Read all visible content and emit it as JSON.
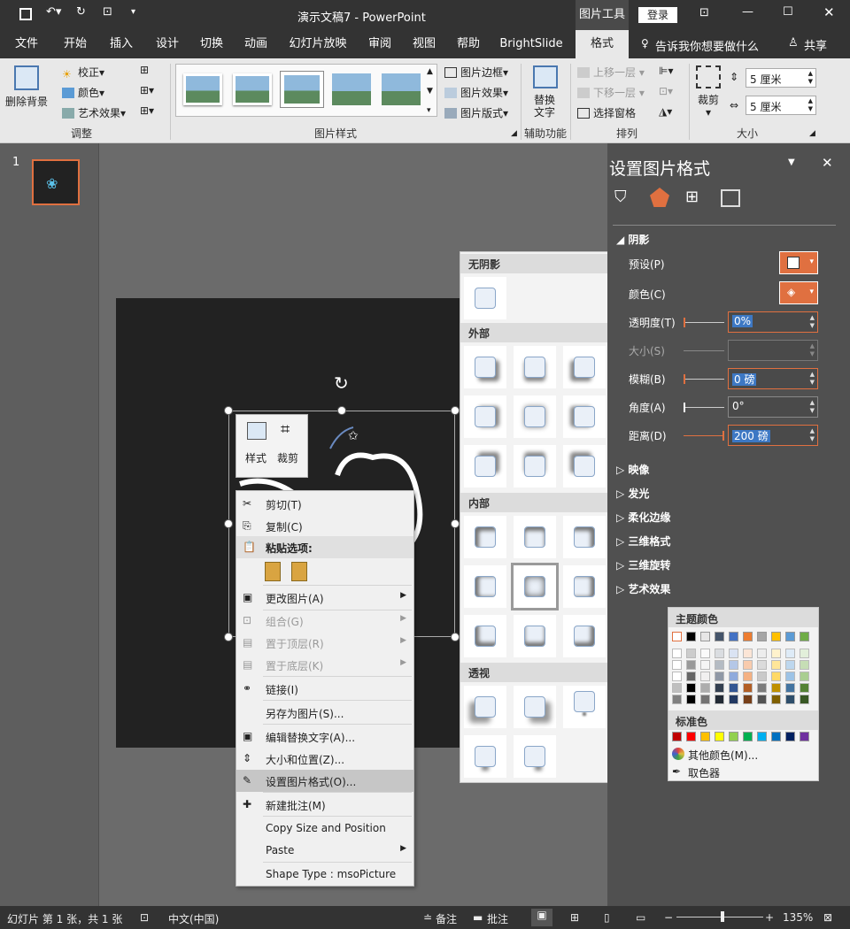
{
  "titlebar": {
    "doc_title": "演示文稿7  -  PowerPoint",
    "context_tab": "图片工具",
    "login": "登录"
  },
  "tabs": [
    "文件",
    "开始",
    "插入",
    "设计",
    "切换",
    "动画",
    "幻灯片放映",
    "审阅",
    "视图",
    "帮助",
    "BrightSlide",
    "格式"
  ],
  "tell_me": "告诉我你想要做什么",
  "share": "共享",
  "ribbon": {
    "remove_bg": "删除背景",
    "correct": "校正",
    "color": "颜色",
    "art_effect": "艺术效果",
    "group_adjust": "调整",
    "group_styles": "图片样式",
    "border": "图片边框",
    "effect": "图片效果",
    "layout": "图片版式",
    "alt_text": "替换\n文字",
    "alt_text_l1": "替换",
    "alt_text_l2": "文字",
    "group_assist": "辅助功能",
    "bring_fwd": "上移一层",
    "send_back": "下移一层",
    "selection_pane": "选择窗格",
    "group_arrange": "排列",
    "crop": "裁剪",
    "height": "5 厘米",
    "width": "5 厘米",
    "group_size": "大小"
  },
  "thumbs": {
    "num": "1"
  },
  "mini_toolbar": {
    "style": "样式",
    "crop": "裁剪"
  },
  "context_menu": [
    {
      "label": "剪切(T)",
      "dis": false
    },
    {
      "label": "复制(C)",
      "dis": false
    },
    {
      "label": "粘贴选项:",
      "dis": false
    },
    {
      "label": "更改图片(A)",
      "dis": false
    },
    {
      "label": "组合(G)",
      "dis": true
    },
    {
      "label": "置于顶层(R)",
      "dis": true
    },
    {
      "label": "置于底层(K)",
      "dis": true
    },
    {
      "label": "链接(I)",
      "dis": false
    },
    {
      "label": "另存为图片(S)...",
      "dis": false
    },
    {
      "label": "编辑替换文字(A)...",
      "dis": false
    },
    {
      "label": "大小和位置(Z)...",
      "dis": false
    },
    {
      "label": "设置图片格式(O)...",
      "dis": false
    },
    {
      "label": "新建批注(M)",
      "dis": false
    },
    {
      "label": "Copy Size and Position",
      "dis": false
    },
    {
      "label": "Paste",
      "dis": false
    },
    {
      "label": "Shape Type : msoPicture",
      "dis": false
    }
  ],
  "gallery": {
    "no_shadow": "无阴影",
    "outer": "外部",
    "inner": "内部",
    "perspective": "透视"
  },
  "pane": {
    "title": "设置图片格式",
    "shadow": "阴影",
    "preset": "预设(P)",
    "color": "颜色(C)",
    "transparency": "透明度(T)",
    "transparency_val": "0%",
    "size": "大小(S)",
    "blur": "模糊(B)",
    "blur_val": "0 磅",
    "angle": "角度(A)",
    "angle_val": "0°",
    "distance": "距离(D)",
    "distance_val": "200 磅",
    "reflection": "映像",
    "glow": "发光",
    "soft_edges": "柔化边缘",
    "format_3d": "三维格式",
    "rotation_3d": "三维旋转",
    "art_effects": "艺术效果"
  },
  "color_popup": {
    "theme": "主题颜色",
    "standard": "标准色",
    "more": "其他颜色(M)...",
    "eyedropper": "取色器",
    "theme_top": [
      "#ffffff",
      "#000000",
      "#e7e6e6",
      "#44546a",
      "#4472c4",
      "#ed7d31",
      "#a5a5a5",
      "#ffc000",
      "#5b9bd5",
      "#70ad47"
    ],
    "standard_colors": [
      "#c00000",
      "#ff0000",
      "#ffc000",
      "#ffff00",
      "#92d050",
      "#00b050",
      "#00b0f0",
      "#0070c0",
      "#002060",
      "#7030a0"
    ]
  },
  "status": {
    "slide_info": "幻灯片 第 1 张，共 1 张",
    "lang": "中文(中国)",
    "notes": "备注",
    "comments": "批注",
    "zoom": "135%"
  }
}
